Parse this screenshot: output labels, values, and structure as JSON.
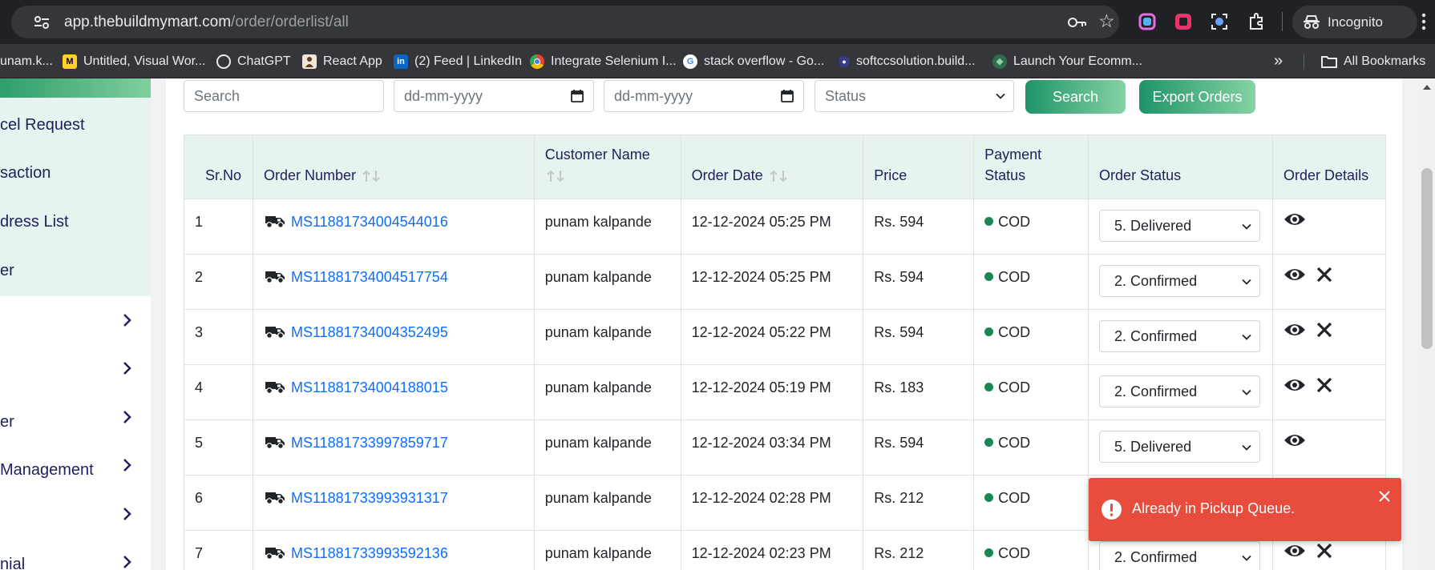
{
  "browser": {
    "url_host": "app.thebuildmymart.com",
    "url_path": "/order/orderlist/all",
    "incognito_label": "Incognito",
    "bookmarks": [
      {
        "label": "unam.k...",
        "icon": "folder-icon"
      },
      {
        "label": "Untitled, Visual Wor...",
        "icon": "miro-icon"
      },
      {
        "label": "ChatGPT",
        "icon": "chatgpt-icon"
      },
      {
        "label": "React App",
        "icon": "react-app-icon"
      },
      {
        "label": "(2) Feed | LinkedIn",
        "icon": "linkedin-icon"
      },
      {
        "label": "Integrate Selenium I...",
        "icon": "chrome-icon"
      },
      {
        "label": "stack overflow - Go...",
        "icon": "google-icon"
      },
      {
        "label": "softccsolution.build...",
        "icon": "site-icon"
      },
      {
        "label": "Launch Your Ecomm...",
        "icon": "shopify-icon"
      }
    ],
    "all_bookmarks_label": "All Bookmarks"
  },
  "sidebar": {
    "items": [
      {
        "label": "cel Request"
      },
      {
        "label": "saction"
      },
      {
        "label": "dress List"
      },
      {
        "label": "er"
      }
    ],
    "groups": [
      {
        "label": ""
      },
      {
        "label": ""
      },
      {
        "label": "er"
      },
      {
        "label": "Management"
      },
      {
        "label": ""
      },
      {
        "label": "nial"
      }
    ]
  },
  "filters": {
    "search_placeholder": "Search",
    "date_from_placeholder": "dd-mm-yyyy",
    "date_to_placeholder": "dd-mm-yyyy",
    "status_placeholder": "Status",
    "search_button": "Search",
    "export_button": "Export Orders"
  },
  "table": {
    "headers": {
      "sr_no": "Sr.No",
      "order_number": "Order Number",
      "customer_name": "Customer Name",
      "order_date": "Order Date",
      "price": "Price",
      "payment_status": "Payment Status",
      "order_status": "Order Status",
      "order_details": "Order Details"
    },
    "rows": [
      {
        "sr": "1",
        "order": "MS11881734004544016",
        "customer": "punam kalpande",
        "date": "12-12-2024 05:25 PM",
        "price": "Rs. 594",
        "payment": "COD",
        "status": "5. Delivered",
        "cancel": false
      },
      {
        "sr": "2",
        "order": "MS11881734004517754",
        "customer": "punam kalpande",
        "date": "12-12-2024 05:25 PM",
        "price": "Rs. 594",
        "payment": "COD",
        "status": "2. Confirmed",
        "cancel": true
      },
      {
        "sr": "3",
        "order": "MS11881734004352495",
        "customer": "punam kalpande",
        "date": "12-12-2024 05:22 PM",
        "price": "Rs. 594",
        "payment": "COD",
        "status": "2. Confirmed",
        "cancel": true
      },
      {
        "sr": "4",
        "order": "MS11881734004188015",
        "customer": "punam kalpande",
        "date": "12-12-2024 05:19 PM",
        "price": "Rs. 183",
        "payment": "COD",
        "status": "2. Confirmed",
        "cancel": true
      },
      {
        "sr": "5",
        "order": "MS11881733997859717",
        "customer": "punam kalpande",
        "date": "12-12-2024 03:34 PM",
        "price": "Rs. 594",
        "payment": "COD",
        "status": "5. Delivered",
        "cancel": false
      },
      {
        "sr": "6",
        "order": "MS11881733993931317",
        "customer": "punam kalpande",
        "date": "12-12-2024 02:28 PM",
        "price": "Rs. 212",
        "payment": "COD",
        "status": "",
        "cancel": false
      },
      {
        "sr": "7",
        "order": "MS11881733993592136",
        "customer": "punam kalpande",
        "date": "12-12-2024 02:23 PM",
        "price": "Rs. 212",
        "payment": "COD",
        "status": "2. Confirmed",
        "cancel": true
      }
    ]
  },
  "toast": {
    "message": "Already in Pickup Queue."
  },
  "colors": {
    "accent_green": "#1f9467",
    "header_bg": "#e6f3ee",
    "link_blue": "#0d6efd",
    "toast_red": "#e74c3c",
    "payment_dot": "#198754"
  }
}
